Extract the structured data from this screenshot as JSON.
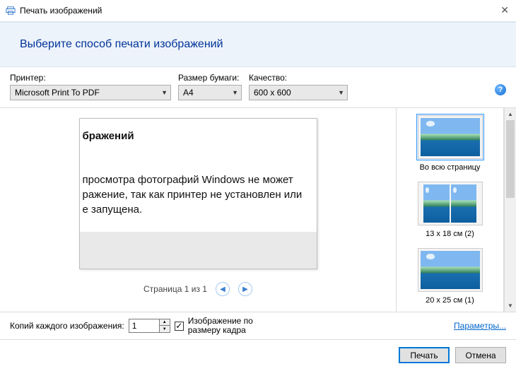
{
  "titlebar": {
    "title": "Печать изображений",
    "close": "✕"
  },
  "banner": {
    "heading": "Выберите способ печати изображений"
  },
  "controls": {
    "printer": {
      "label": "Принтер:",
      "value": "Microsoft Print To PDF"
    },
    "paper": {
      "label": "Размер бумаги:",
      "value": "A4"
    },
    "quality": {
      "label": "Качество:",
      "value": "600 x 600"
    }
  },
  "preview": {
    "l1": "бражений",
    "l2": "просмотра фотографий Windows не может",
    "l3": "ражение, так как принтер не установлен или",
    "l4": "е запущена."
  },
  "pager": {
    "label": "Страница 1 из 1"
  },
  "layouts": {
    "opt1": "Во всю страницу",
    "opt2": "13 x 18 см (2)",
    "opt3": "20 x 25 см (1)"
  },
  "copies": {
    "label": "Копий каждого изображения:",
    "value": "1",
    "fit_label": "Изображение по размеру кадра",
    "fit_checked": "✓"
  },
  "link": "Параметры...",
  "buttons": {
    "print": "Печать",
    "cancel": "Отмена"
  }
}
